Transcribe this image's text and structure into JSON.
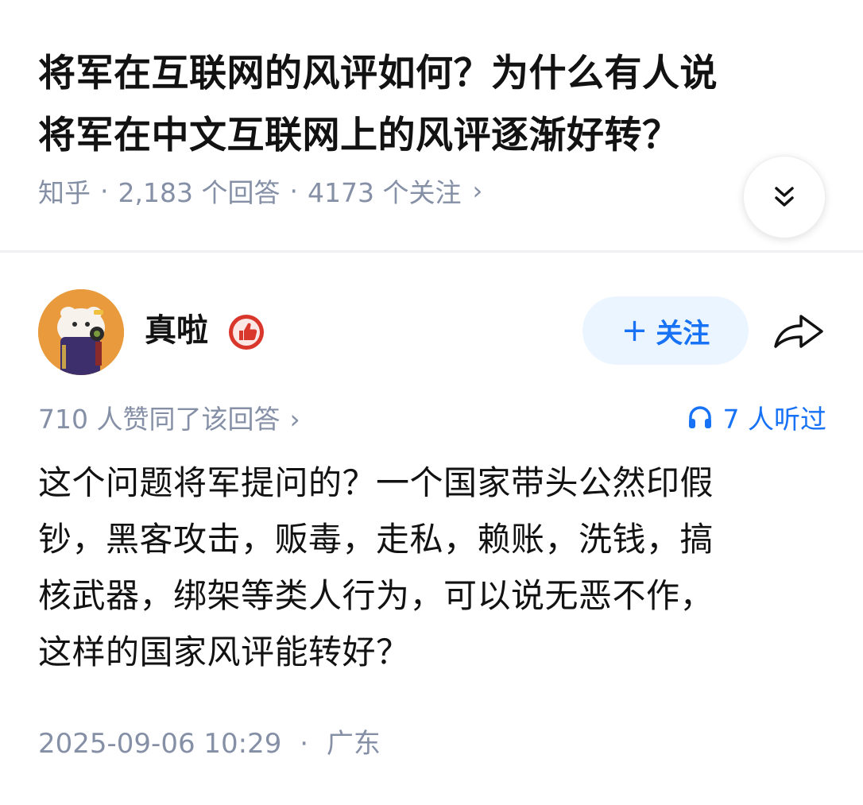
{
  "question": {
    "title_line1": "将军在互联网的风评如何？为什么有人说",
    "title_line2": "将军在中文互联网上的风评逐渐好转？",
    "source": "知乎",
    "separator": "·",
    "answers_count": "2,183 个回答",
    "followers_count": "4173 个关注",
    "chevron": "›"
  },
  "icons": {
    "expand": "double-chevron-down-icon",
    "badge": "thumbs-up-badge-icon",
    "share": "share-arrow-icon",
    "headphones": "headphones-icon"
  },
  "author": {
    "name": "真啦",
    "follow_plus": "+",
    "follow_label": "关注"
  },
  "answer": {
    "upvotes_text": "710 人赞同了该回答",
    "upvotes_chevron": "›",
    "listened_text": "7 人听过",
    "content_lines": [
      "这个问题将军提问的？一个国家带头公然印假",
      "钞，黑客攻击，贩毒，走私，赖账，洗钱，搞",
      "核武器，绑架等类人行为，可以说无恶不作，",
      "这样的国家风评能转好？"
    ],
    "date": "2025-09-06 10:29",
    "separator": "·",
    "location": "广东"
  },
  "colors": {
    "accent": "#1772f6",
    "follow_bg": "#ebf5ff",
    "meta_gray": "#8590a6",
    "badge_red": "#d9362c",
    "avatar_bg": "#e89a3c"
  }
}
